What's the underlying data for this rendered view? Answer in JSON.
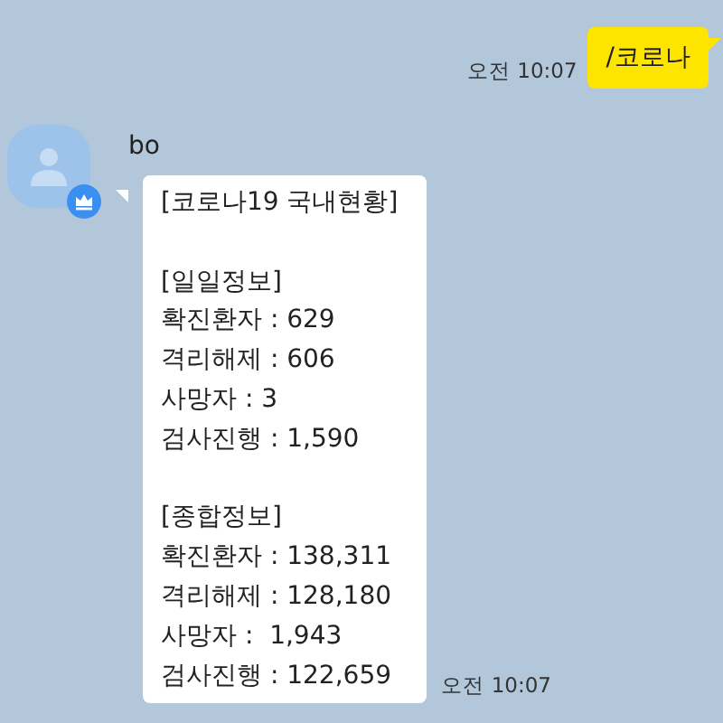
{
  "messages": [
    {
      "kind": "sent",
      "time": "오전 10:07",
      "text": "/코로나"
    },
    {
      "kind": "received",
      "sender": "bo",
      "time": "오전 10:07",
      "blocks": [
        [
          "[코로나19 국내현황]"
        ],
        [
          "[일일정보]",
          "확진환자 : 629",
          "격리해제 : 606",
          "사망자 : 3",
          "검사진행 : 1,590"
        ],
        [
          "[종합정보]",
          "확진환자 : 138,311",
          "격리해제 : 128,180",
          "사망자 :  1,943",
          "검사진행 : 122,659"
        ]
      ]
    }
  ]
}
